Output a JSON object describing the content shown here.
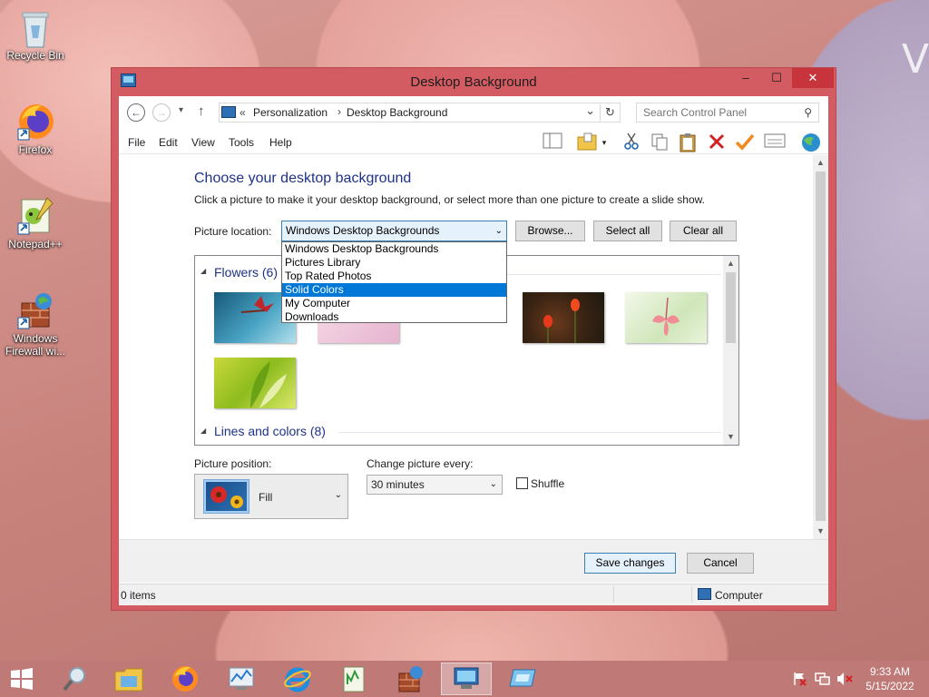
{
  "desktop": {
    "icons": [
      {
        "label": "Recycle Bin"
      },
      {
        "label": "Firefox"
      },
      {
        "label": "Notepad++"
      },
      {
        "label": "Windows Firewall wi..."
      }
    ],
    "wallpaper_glyph": "V"
  },
  "window": {
    "title": "Desktop Background",
    "buttons": {
      "minimize": "–",
      "maximize": "☐",
      "close": "✕"
    }
  },
  "address": {
    "back": "←",
    "forward": "→",
    "recent": "▾",
    "up": "↑",
    "prefix": "«",
    "crumb1": "Personalization",
    "crumb_sep": "›",
    "crumb2": "Desktop Background",
    "dropdown": "⌄",
    "refresh": "↻",
    "search_placeholder": "Search Control Panel",
    "search_icon": "⚲"
  },
  "menu": {
    "file": "File",
    "edit": "Edit",
    "view": "View",
    "tools": "Tools",
    "help": "Help"
  },
  "page": {
    "heading": "Choose your desktop background",
    "subtext": "Click a picture to make it your desktop background, or select more than one picture to create a slide show.",
    "location_label": "Picture location:",
    "location_value": "Windows Desktop Backgrounds",
    "browse": "Browse...",
    "select_all": "Select all",
    "clear_all": "Clear all"
  },
  "dropdown_options": [
    "Windows Desktop Backgrounds",
    "Pictures Library",
    "Top Rated Photos",
    "Solid Colors",
    "My Computer",
    "Downloads"
  ],
  "dropdown_selected_index": 3,
  "gallery": {
    "group1": "Flowers (6)",
    "group2": "Lines and colors (8)",
    "expand_glyph": "◢"
  },
  "position": {
    "label": "Picture position:",
    "value": "Fill",
    "change_label": "Change picture every:",
    "change_value": "30 minutes",
    "shuffle": "Shuffle"
  },
  "footer": {
    "save": "Save changes",
    "cancel": "Cancel"
  },
  "status": {
    "items": "0 items",
    "computer": "Computer"
  },
  "clock": {
    "time": "9:33 AM",
    "date": "5/15/2022"
  },
  "colors": {
    "title_bar": "#d35c62",
    "heading": "#1e3287",
    "selection": "#0078d7"
  }
}
